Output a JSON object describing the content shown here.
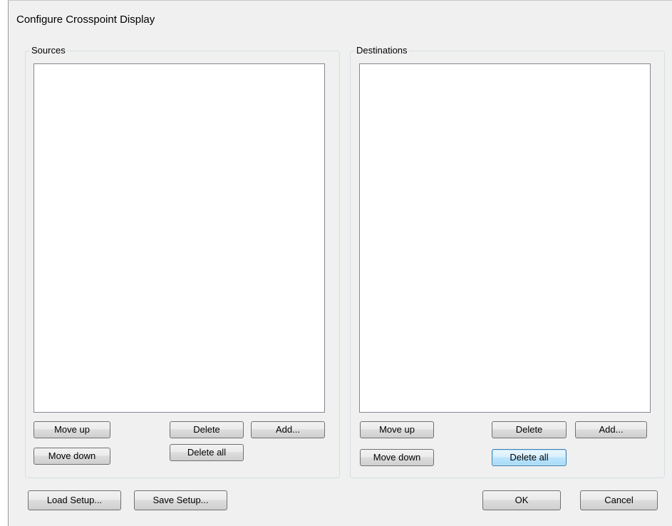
{
  "window": {
    "title": "Configure Crosspoint Display"
  },
  "sources": {
    "legend": "Sources",
    "items": [],
    "buttons": {
      "move_up": "Move up",
      "move_down": "Move down",
      "delete": "Delete",
      "delete_all": "Delete all",
      "add": "Add..."
    }
  },
  "destinations": {
    "legend": "Destinations",
    "items": [],
    "buttons": {
      "move_up": "Move up",
      "move_down": "Move down",
      "delete": "Delete",
      "delete_all": "Delete all",
      "add": "Add..."
    }
  },
  "footer": {
    "load_setup": "Load Setup...",
    "save_setup": "Save Setup...",
    "ok": "OK",
    "cancel": "Cancel"
  },
  "colors": {
    "dialog_background": "#f0f0f0",
    "listbox_background": "#ffffff",
    "group_border": "#d5dfe5",
    "focus_border": "#3c7fb1"
  }
}
